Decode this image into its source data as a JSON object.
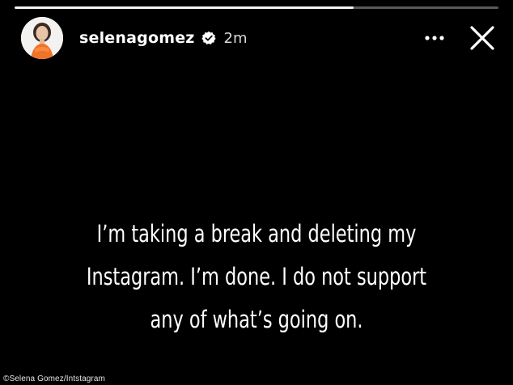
{
  "story": {
    "progress_fraction": 0.7,
    "user": {
      "username": "selenagomez",
      "verified": true,
      "posted_ago": "2m",
      "avatar_icon": "profile-avatar"
    },
    "controls": {
      "more_icon": "more-options-icon",
      "close_icon": "close-icon"
    },
    "text_lines": [
      "I’m taking a break and deleting my",
      "Instagram. I’m done. I do not support",
      "any of what’s going on."
    ],
    "background_color": "#000000",
    "text_color": "#ffffff"
  },
  "credit": "©Selena Gomez/Intstagram"
}
